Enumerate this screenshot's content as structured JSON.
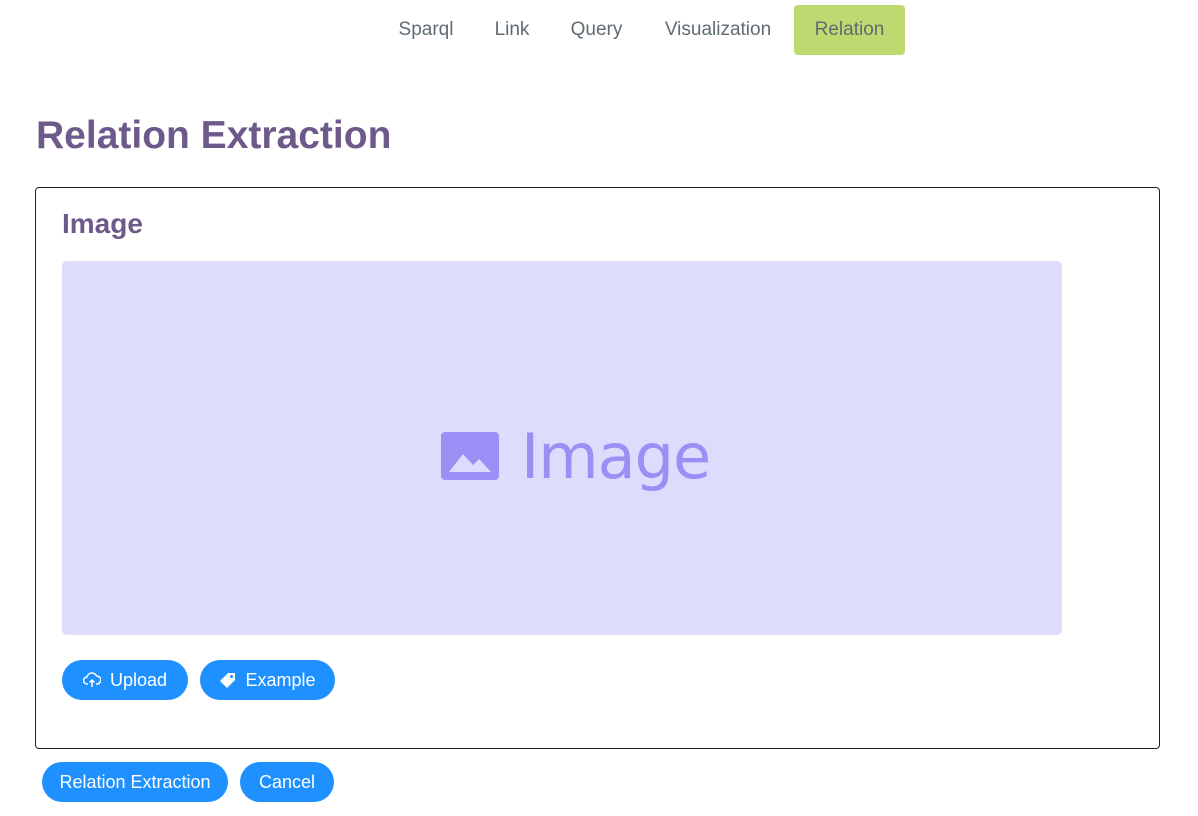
{
  "nav": {
    "items": [
      {
        "label": "Sparql",
        "active": false
      },
      {
        "label": "Link",
        "active": false
      },
      {
        "label": "Query",
        "active": false
      },
      {
        "label": "Visualization",
        "active": false
      },
      {
        "label": "Relation",
        "active": true
      }
    ],
    "active_color": "#bfd971"
  },
  "page": {
    "title": "Relation Extraction"
  },
  "image_panel": {
    "title": "Image",
    "placeholder_text": "Image",
    "upload_label": "Upload",
    "example_label": "Example"
  },
  "actions": {
    "extract_label": "Relation Extraction",
    "cancel_label": "Cancel"
  },
  "colors": {
    "primary": "#1e90ff",
    "heading": "#6e5a8a",
    "image_bg": "#dcdcfd",
    "image_fg": "#9a8ff5"
  }
}
